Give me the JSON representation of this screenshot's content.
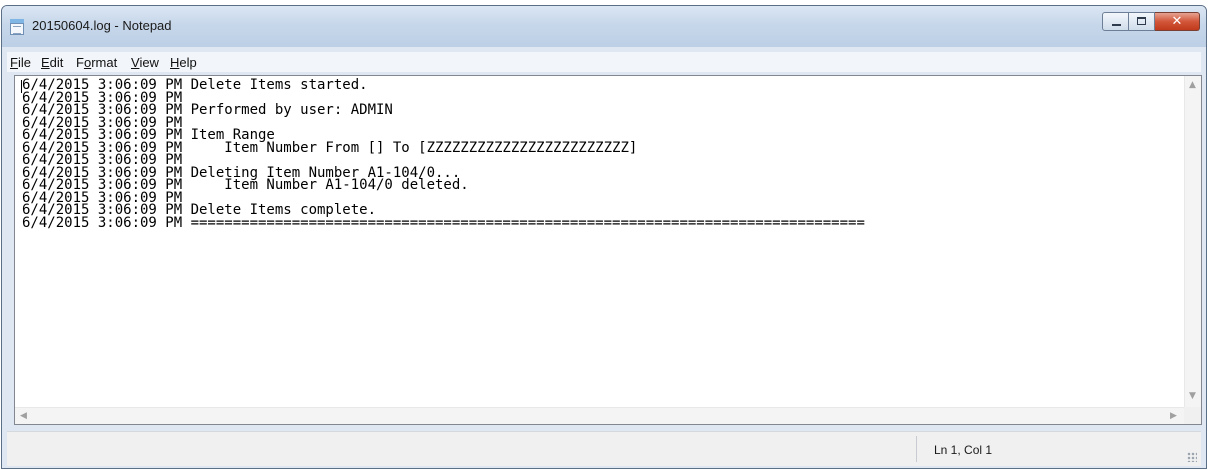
{
  "window": {
    "title": "20150604.log - Notepad",
    "close_label": "✕"
  },
  "menu": [
    {
      "accel": "F",
      "rest": "ile"
    },
    {
      "accel": "E",
      "rest": "dit"
    },
    {
      "pre": "F",
      "accel": "o",
      "rest": "rmat"
    },
    {
      "accel": "V",
      "rest": "iew"
    },
    {
      "accel": "H",
      "rest": "elp"
    }
  ],
  "document": {
    "lines": [
      "6/4/2015 3:06:09 PM Delete Items started.",
      "6/4/2015 3:06:09 PM",
      "6/4/2015 3:06:09 PM Performed by user: ADMIN",
      "6/4/2015 3:06:09 PM",
      "6/4/2015 3:06:09 PM Item Range",
      "6/4/2015 3:06:09 PM     Item Number From [] To [ZZZZZZZZZZZZZZZZZZZZZZZZ]",
      "6/4/2015 3:06:09 PM",
      "6/4/2015 3:06:09 PM Deleting Item Number A1-104/0...",
      "6/4/2015 3:06:09 PM     Item Number A1-104/0 deleted.",
      "6/4/2015 3:06:09 PM",
      "6/4/2015 3:06:09 PM Delete Items complete.",
      "6/4/2015 3:06:09 PM ================================================================================"
    ]
  },
  "scroll": {
    "up": "▲",
    "down": "▼",
    "left": "◀",
    "right": "▶"
  },
  "status": {
    "position": "Ln 1, Col 1"
  },
  "colors": {
    "titlebar": "#c7d7ea",
    "close_button": "#c13a1c",
    "client_background": "#ffffff"
  }
}
